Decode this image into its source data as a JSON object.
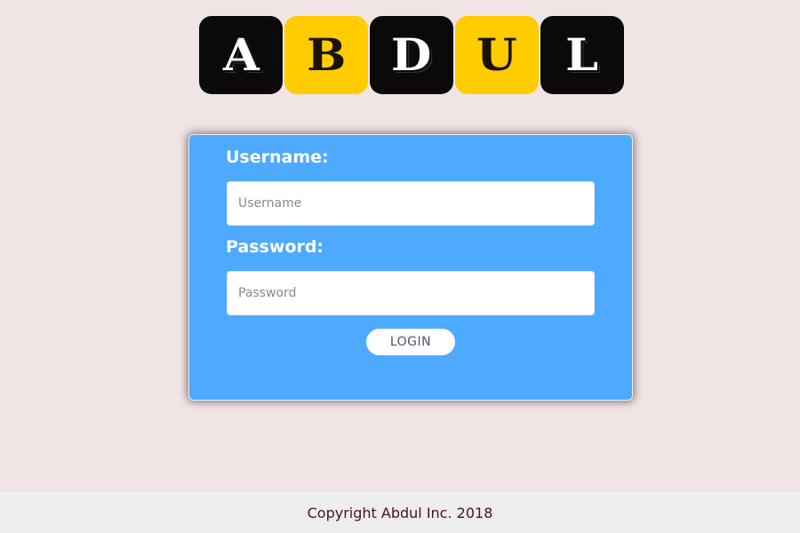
{
  "logo": {
    "letters": [
      "A",
      "B",
      "D",
      "U",
      "L"
    ],
    "colors": {
      "dark": "#0a0a0a",
      "yellow": "#ffcc00"
    }
  },
  "form": {
    "username_label": "Username:",
    "username_placeholder": "Username",
    "username_value": "",
    "password_label": "Password:",
    "password_placeholder": "Password",
    "password_value": "",
    "login_label": "LOGIN"
  },
  "footer": {
    "text": "Copyright Abdul Inc. 2018"
  },
  "colors": {
    "page_background": "#f1e4e5",
    "card_background": "#4eaaff",
    "footer_background": "#eeeeee",
    "footer_text": "#4a0e2e"
  }
}
